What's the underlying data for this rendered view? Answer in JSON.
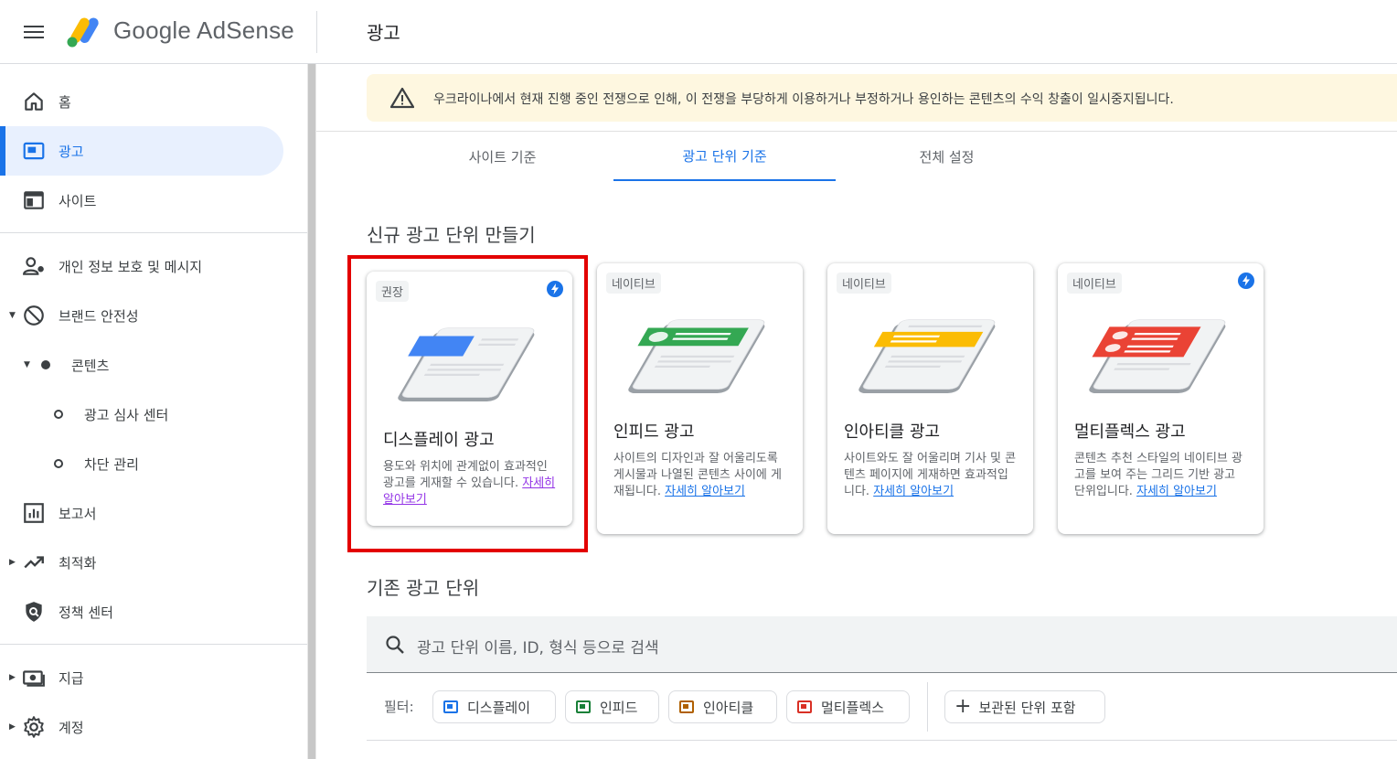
{
  "app": {
    "brand": "Google AdSense",
    "page_title": "광고"
  },
  "sidebar": {
    "items": [
      {
        "label": "홈"
      },
      {
        "label": "광고"
      },
      {
        "label": "사이트"
      },
      {
        "label": "개인 정보 보호 및 메시지"
      },
      {
        "label": "브랜드 안전성"
      },
      {
        "label": "콘텐츠"
      },
      {
        "label": "광고 심사 센터"
      },
      {
        "label": "차단 관리"
      },
      {
        "label": "보고서"
      },
      {
        "label": "최적화"
      },
      {
        "label": "정책 센터"
      },
      {
        "label": "지급"
      },
      {
        "label": "계정"
      }
    ]
  },
  "alert": {
    "text": "우크라이나에서 현재 진행 중인 전쟁으로 인해, 이 전쟁을 부당하게 이용하거나 부정하거나 용인하는 콘텐츠의 수익 창출이 일시중지됩니다."
  },
  "tabs": [
    {
      "label": "사이트 기준"
    },
    {
      "label": "광고 단위 기준"
    },
    {
      "label": "전체 설정"
    }
  ],
  "new_section": {
    "title": "신규 광고 단위 만들기"
  },
  "cards": [
    {
      "chip": "권장",
      "title": "디스플레이 광고",
      "desc": "용도와 위치에 관계없이 효과적인 광고를 게재할 수 있습니다.",
      "link": "자세히 알아보기"
    },
    {
      "chip": "네이티브",
      "title": "인피드 광고",
      "desc": "사이트의 디자인과 잘 어울리도록 게시물과 나열된 콘텐츠 사이에 게재됩니다.",
      "link": "자세히 알아보기"
    },
    {
      "chip": "네이티브",
      "title": "인아티클 광고",
      "desc": "사이트와도 잘 어울리며 기사 및 콘텐츠 페이지에 게재하면 효과적입니다.",
      "link": "자세히 알아보기"
    },
    {
      "chip": "네이티브",
      "title": "멀티플렉스 광고",
      "desc": "콘텐츠 추천 스타일의 네이티브 광고를 보여 주는 그리드 기반 광고 단위입니다.",
      "link": "자세히 알아보기"
    }
  ],
  "existing_section": {
    "title": "기존 광고 단위"
  },
  "search": {
    "placeholder": "광고 단위 이름, ID, 형식 등으로 검색"
  },
  "filters": {
    "label": "필터:",
    "chips": [
      {
        "label": "디스플레이",
        "color": "#1a73e8"
      },
      {
        "label": "인피드",
        "color": "#188038"
      },
      {
        "label": "인아티클",
        "color": "#b06000"
      },
      {
        "label": "멀티플렉스",
        "color": "#d93025"
      }
    ],
    "archived": "보관된 단위 포함"
  }
}
